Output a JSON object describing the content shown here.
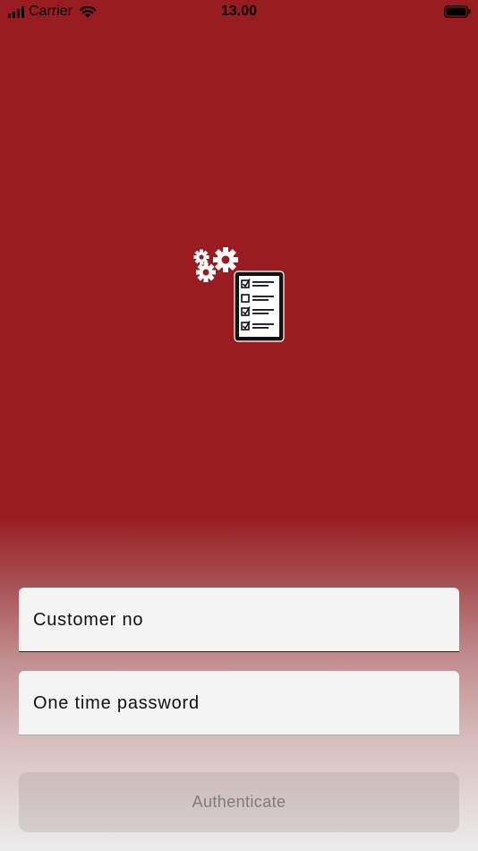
{
  "status_bar": {
    "carrier": "Carrier",
    "time": "13.00"
  },
  "form": {
    "customer_field": {
      "label": "Customer no"
    },
    "otp_field": {
      "label": "One time password"
    },
    "authenticate_button": {
      "label": "Authenticate",
      "enabled": false
    }
  },
  "colors": {
    "brand": "#991c20",
    "button_text_disabled": "#7f7b7b"
  },
  "icons": {
    "signal": "signal-icon",
    "wifi": "wifi-icon",
    "battery": "battery-icon",
    "logo": "gears-checklist-logo"
  }
}
